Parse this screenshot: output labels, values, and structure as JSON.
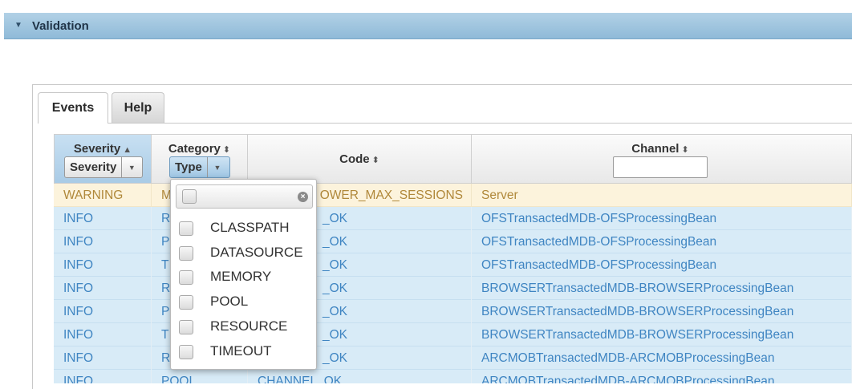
{
  "panel": {
    "title": "Validation"
  },
  "tabs": [
    {
      "label": "Events",
      "active": true
    },
    {
      "label": "Help",
      "active": false
    }
  ],
  "columns": {
    "severity": {
      "label": "Severity",
      "sort_icon": "▲",
      "filter_value": "Severity"
    },
    "category": {
      "label": "Category",
      "sort_icon": "⬍",
      "filter_value": "Type"
    },
    "code": {
      "label": "Code",
      "sort_icon": "⬍"
    },
    "channel": {
      "label": "Channel",
      "sort_icon": "⬍",
      "filter_value": ""
    }
  },
  "rows": [
    {
      "severity": "WARNING",
      "category": "M",
      "code": "OWER_MAX_SESSIONS",
      "channel": "Server"
    },
    {
      "severity": "INFO",
      "category": "R",
      "code": "_OK",
      "channel": "OFSTransactedMDB-OFSProcessingBean"
    },
    {
      "severity": "INFO",
      "category": "P",
      "code": "_OK",
      "channel": "OFSTransactedMDB-OFSProcessingBean"
    },
    {
      "severity": "INFO",
      "category": "T",
      "code": "_OK",
      "channel": "OFSTransactedMDB-OFSProcessingBean"
    },
    {
      "severity": "INFO",
      "category": "R",
      "code": "_OK",
      "channel": "BROWSERTransactedMDB-BROWSERProcessingBean"
    },
    {
      "severity": "INFO",
      "category": "P",
      "code": "_OK",
      "channel": "BROWSERTransactedMDB-BROWSERProcessingBean"
    },
    {
      "severity": "INFO",
      "category": "T",
      "code": "_OK",
      "channel": "BROWSERTransactedMDB-BROWSERProcessingBean"
    },
    {
      "severity": "INFO",
      "category": "R",
      "code": "_OK",
      "channel": "ARCMOBTransactedMDB-ARCMOBProcessingBean"
    },
    {
      "severity": "INFO",
      "category": "POOL",
      "code": "CHANNEL_OK",
      "channel": "ARCMOBTransactedMDB-ARCMOBProcessingBean"
    }
  ],
  "category_dropdown": {
    "options": [
      "CLASSPATH",
      "DATASOURCE",
      "MEMORY",
      "POOL",
      "RESOURCE",
      "TIMEOUT"
    ],
    "clear_icon": "×"
  },
  "colors": {
    "header_bar": "#9fc4df",
    "warning_row": "#fcf3dc",
    "info_row": "#d8ebf7",
    "info_text": "#3f85c2",
    "warning_text": "#b0883a"
  }
}
